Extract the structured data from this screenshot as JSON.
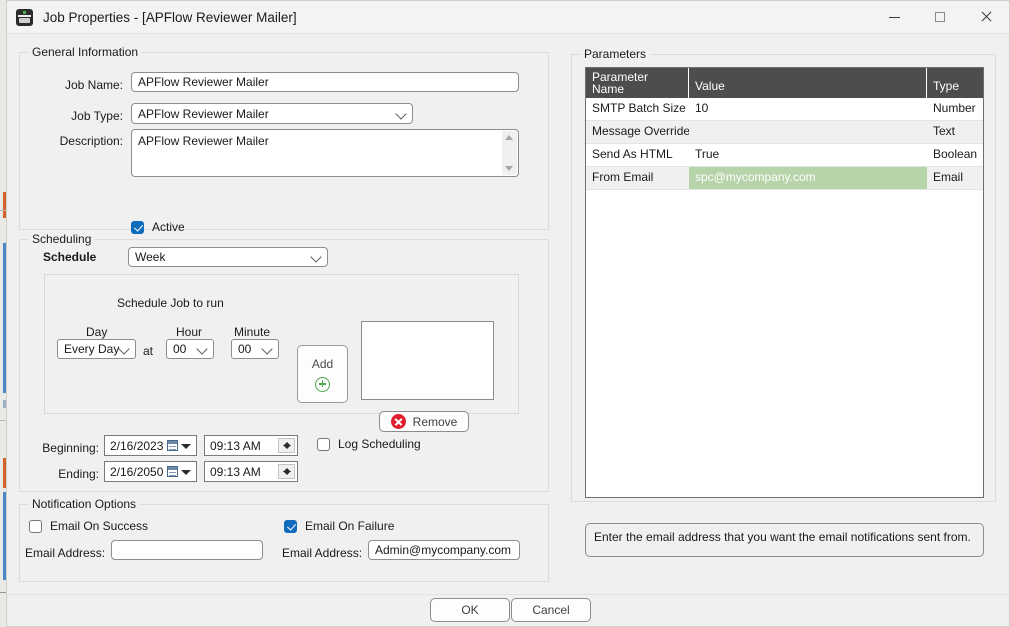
{
  "window": {
    "title": "Job Properties - [APFlow Reviewer Mailer]",
    "icon": "app-icon",
    "minimize_label": "—",
    "maximize_label": "□",
    "close_label": "✕"
  },
  "general": {
    "legend": "General Information",
    "job_name_label": "Job Name:",
    "job_name_value": "APFlow Reviewer Mailer",
    "job_type_label": "Job Type:",
    "job_type_value": "APFlow Reviewer Mailer",
    "description_label": "Description:",
    "description_value": "APFlow Reviewer Mailer",
    "active_label": "Active",
    "active_checked": true
  },
  "scheduling": {
    "legend": "Scheduling",
    "schedule_label": "Schedule",
    "schedule_value": "Week",
    "inner": {
      "title": "Schedule Job to run",
      "day_label": "Day",
      "day_value": "Every Day",
      "at_label": "at",
      "hour_label": "Hour",
      "hour_value": "00",
      "minute_label": "Minute",
      "minute_value": "00",
      "add_label": "Add",
      "remove_label": "Remove",
      "entries": []
    },
    "beginning_label": "Beginning:",
    "beginning_date": "2/16/2023",
    "beginning_time": "09:13 AM",
    "ending_label": "Ending:",
    "ending_date": "2/16/2050",
    "ending_time": "09:13 AM",
    "log_scheduling_label": "Log Scheduling",
    "log_scheduling_checked": false
  },
  "notification": {
    "legend": "Notification Options",
    "success_label": "Email On Success",
    "success_checked": false,
    "success_email_label": "Email Address:",
    "success_email_value": "",
    "failure_label": "Email On Failure",
    "failure_checked": true,
    "failure_email_label": "Email Address:",
    "failure_email_value": "Admin@mycompany.com"
  },
  "parameters": {
    "legend": "Parameters",
    "columns": [
      "Parameter\nName",
      "Value",
      "Type"
    ],
    "column_name_line1": "Parameter",
    "column_name_line2": "Name",
    "column_value": "Value",
    "column_type": "Type",
    "rows": [
      {
        "name": "SMTP Batch Size",
        "value": "10",
        "type": "Number",
        "selected": false
      },
      {
        "name": "Message Override",
        "value": "",
        "type": "Text",
        "selected": false
      },
      {
        "name": "Send As HTML",
        "value": "True",
        "type": "Boolean",
        "selected": false
      },
      {
        "name": "From Email",
        "value": "spc@mycompany.com",
        "type": "Email",
        "selected": true
      }
    ],
    "hint": "Enter the email address that you want the email notifications sent from."
  },
  "footer": {
    "ok_label": "OK",
    "cancel_label": "Cancel"
  },
  "colors": {
    "window_bg": "#f0f0f0",
    "grid_header_bg": "#4d4d4d",
    "selection_green": "#b6d3a9",
    "accent_blue": "#0f6cbd",
    "add_green": "#4ca64c",
    "remove_red": "#e0202c",
    "bg_window_orange": "#d4622a",
    "bg_window_blue": "#4a86c8"
  }
}
